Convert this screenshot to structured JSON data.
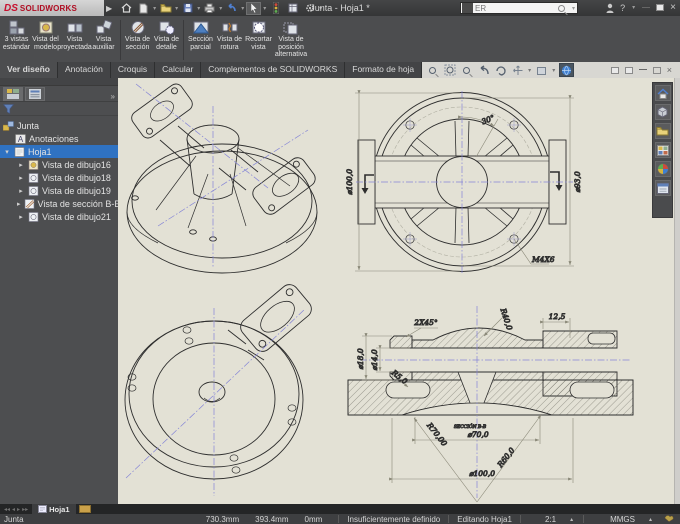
{
  "window": {
    "brand_mark": "DS",
    "brand": "SOLIDWORKS",
    "title": "Junta - Hoja1 *",
    "search_value": "ER"
  },
  "ribbon": {
    "buttons": [
      {
        "label": "3 vistas estándar"
      },
      {
        "label": "Vista del modelo"
      },
      {
        "label": "Vista proyectada"
      },
      {
        "label": "Vista auxiliar"
      },
      {
        "label": "Vista de sección"
      },
      {
        "label": "Vista de detalle"
      },
      {
        "label": "Sección parcial"
      },
      {
        "label": "Vista de rotura"
      },
      {
        "label": "Recortar vista"
      },
      {
        "label": "Vista de posición alternativa"
      }
    ]
  },
  "tabs": [
    "Ver diseño",
    "Anotación",
    "Croquis",
    "Calcular",
    "Complementos de SOLIDWORKS",
    "Formato de hoja"
  ],
  "tree": {
    "root": "Junta",
    "annotations": "Anotaciones",
    "sheet": "Hoja1",
    "views": [
      "Vista de dibujo16",
      "Vista de dibujo18",
      "Vista de dibujo19",
      "Vista de sección B-B",
      "Vista de dibujo21"
    ],
    "chevron": "»"
  },
  "drawing": {
    "front": {
      "dia_outer": "⌀100,0",
      "angle": "30°",
      "dia_inner": "⌀93,0",
      "thread_note": "M4X6"
    },
    "section": {
      "chamfer": "2X45°",
      "dia18": "⌀18,0",
      "dia14": "⌀14,0",
      "r40": "R40,0",
      "w12_5": "12,5",
      "r5": "R5,0",
      "r70": "R70,00",
      "view_label": "SECCIÓN B-B",
      "dia70": "⌀70,0",
      "r60": "R60,0",
      "dia100": "⌀100,0"
    }
  },
  "sheet_bar": {
    "tab": "Hoja1"
  },
  "status": {
    "doc": "Junta",
    "x": "730.3mm",
    "y": "393.4mm",
    "z": "0mm",
    "state": "Insuficientemente definido",
    "mode": "Editando Hoja1",
    "scale": "2:1",
    "units": "MMGS"
  },
  "colors": {
    "accent_blue": "#2f72c2",
    "canvas": "#e3e1d5",
    "centerline": "#8585d6",
    "brand_red": "#c8102e"
  }
}
